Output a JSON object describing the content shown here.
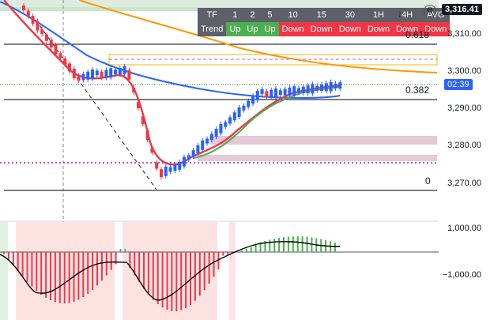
{
  "price_axis": {
    "current_price": "3,316.41",
    "ticks": [
      "3,310.00",
      "3,300.00",
      "3,290.00",
      "3,280.00",
      "3,270.00"
    ],
    "countdown": "02:39"
  },
  "osc_axis": {
    "ticks": [
      "1,000.00",
      "−1,000.00"
    ]
  },
  "fib_levels": {
    "top": "0.618",
    "mid": "0.382",
    "bottom": "0"
  },
  "trend_table": {
    "row_header_tf": "TF",
    "row_header_trend": "Trend",
    "timeframes": [
      "1",
      "2",
      "5",
      "10",
      "15",
      "30",
      "1H",
      "4H",
      "AVG"
    ],
    "trends": [
      "Up",
      "Up",
      "Up",
      "Down",
      "Down",
      "Down",
      "Down",
      "Down",
      "Down"
    ]
  },
  "toolbar": {
    "collapse_icon": "chevron-down-icon",
    "settings_icon": "gear-icon"
  },
  "colors": {
    "up_candle": "#2962ff",
    "down_candle": "#f23645",
    "red_ma": "#f23645",
    "green_ma": "#4caf50",
    "blue_ma": "#2962ff",
    "orange_ma": "#ff9800",
    "current_price_bg": "#2962ff"
  }
}
